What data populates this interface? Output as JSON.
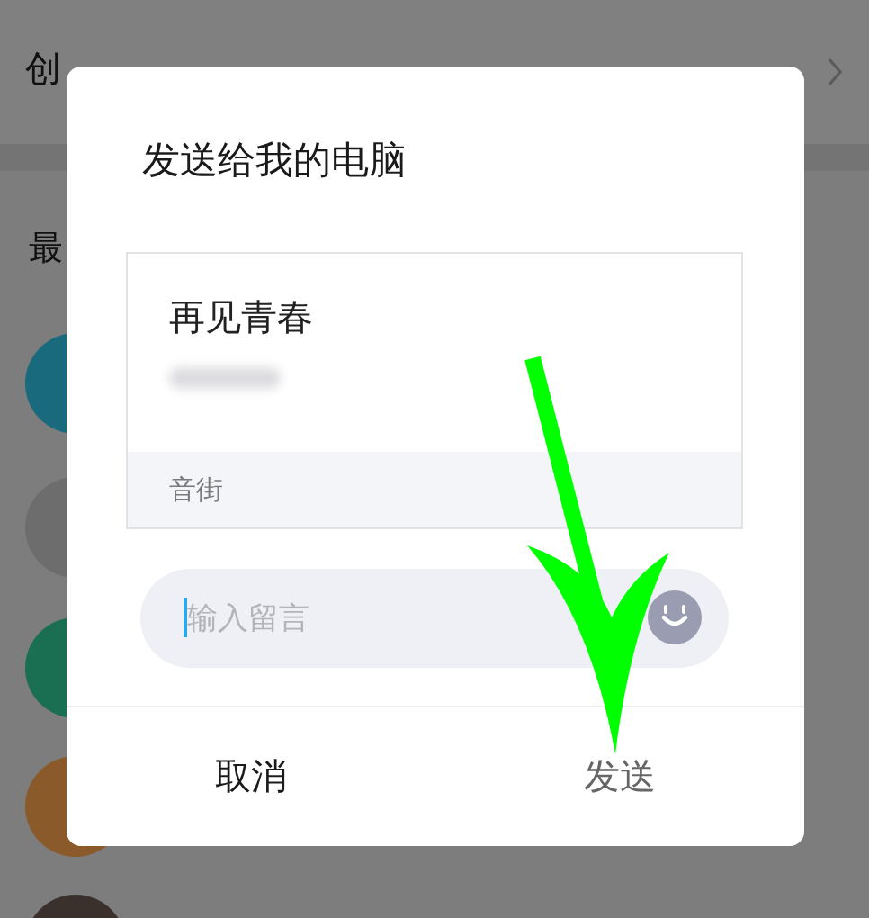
{
  "background": {
    "header_text": "创",
    "section_text": "最"
  },
  "dialog": {
    "title": "发送给我的电脑",
    "card": {
      "title": "再见青春",
      "source": "音街"
    },
    "message_field": {
      "placeholder": "输入留言"
    },
    "buttons": [
      {
        "label": "取消",
        "kind": "cancel"
      },
      {
        "label": "发送",
        "kind": "confirm"
      }
    ]
  }
}
